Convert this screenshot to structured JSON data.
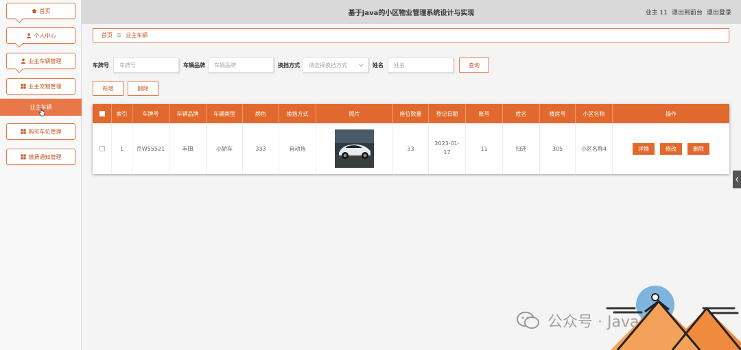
{
  "app": {
    "title": "基于Java的小区物业管理系统设计与实现",
    "user_label": "业主 11",
    "back_label": "退出到前台",
    "logout_label": "退出登录"
  },
  "sidebar": {
    "items": [
      {
        "label": "首页",
        "icon": "home-icon"
      },
      {
        "label": "个人中心",
        "icon": "user-icon"
      },
      {
        "label": "业主车辆管理",
        "icon": "user-icon"
      },
      {
        "label": "业主宠物管理",
        "icon": "grid-icon"
      },
      {
        "label": "购买车位管理",
        "icon": "grid-icon"
      },
      {
        "label": "缴费通知管理",
        "icon": "grid-icon"
      }
    ],
    "active_sub": "业主车辆"
  },
  "breadcrumb": {
    "home": "首页",
    "sep": "☰",
    "current": "业主车辆"
  },
  "search": {
    "plate_label": "车牌号",
    "plate_placeholder": "车牌号",
    "brand_label": "车辆品牌",
    "brand_placeholder": "车辆品牌",
    "method_label": "换挡方式",
    "method_placeholder": "请选择换挡方式",
    "name_label": "姓名",
    "name_placeholder": "姓名",
    "query_button": "查询"
  },
  "actions": {
    "add": "新增",
    "delete": "删除"
  },
  "table": {
    "headers": [
      "索引",
      "车牌号",
      "车辆品牌",
      "车辆类型",
      "颜色",
      "换挡方式",
      "照片",
      "座位数量",
      "登记日期",
      "账号",
      "姓名",
      "楼房号",
      "小区名称",
      "操作"
    ],
    "rows": [
      {
        "index": "1",
        "plate": "京W55521",
        "brand": "丰田",
        "type": "小轿车",
        "color": "333",
        "method": "自动挡",
        "seats": "33",
        "date": "2023-01-17",
        "account": "11",
        "name": "归还",
        "building": "305",
        "community": "小区名称4",
        "btn_detail": "详情",
        "btn_edit": "修改",
        "btn_delete": "删除"
      }
    ]
  },
  "watermark": {
    "text": "公众号 · Java码库"
  },
  "colors": {
    "accent": "#e2692d",
    "border": "#e0784a"
  }
}
